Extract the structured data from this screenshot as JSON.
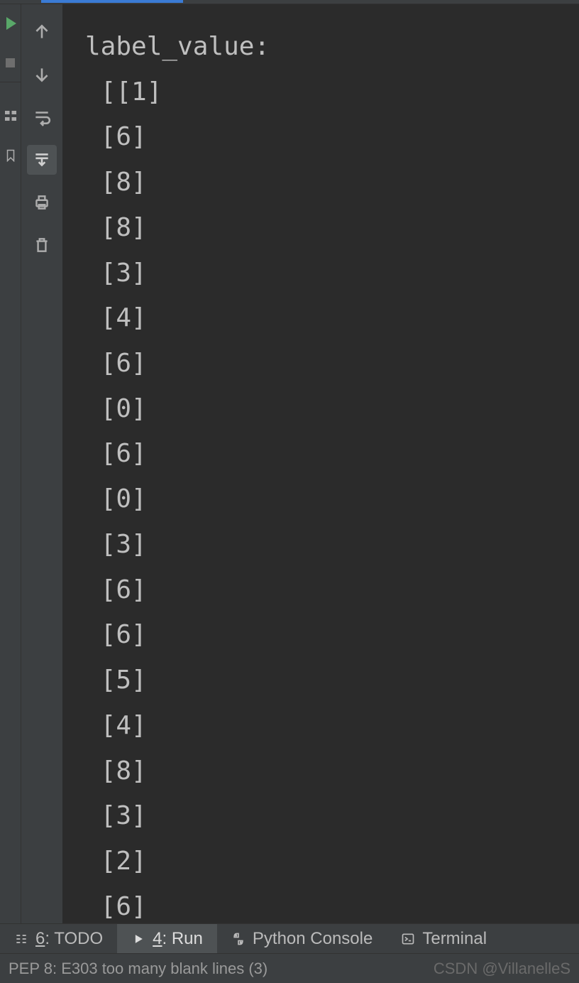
{
  "console": {
    "header": "label_value:",
    "lines": [
      " [[1]",
      " [6]",
      " [8]",
      " [8]",
      " [3]",
      " [4]",
      " [6]",
      " [0]",
      " [6]",
      " [0]",
      " [3]",
      " [6]",
      " [6]",
      " [5]",
      " [4]",
      " [8]",
      " [3]",
      " [2]",
      " [6]"
    ]
  },
  "bottom_tabs": {
    "todo": {
      "num": "6",
      "label": ": TODO"
    },
    "run": {
      "num": "4",
      "label": ": Run"
    },
    "python_console": "Python Console",
    "terminal": "Terminal"
  },
  "status": {
    "message": "PEP 8: E303 too many blank lines (3)"
  },
  "watermark": "CSDN @VillanelleS"
}
